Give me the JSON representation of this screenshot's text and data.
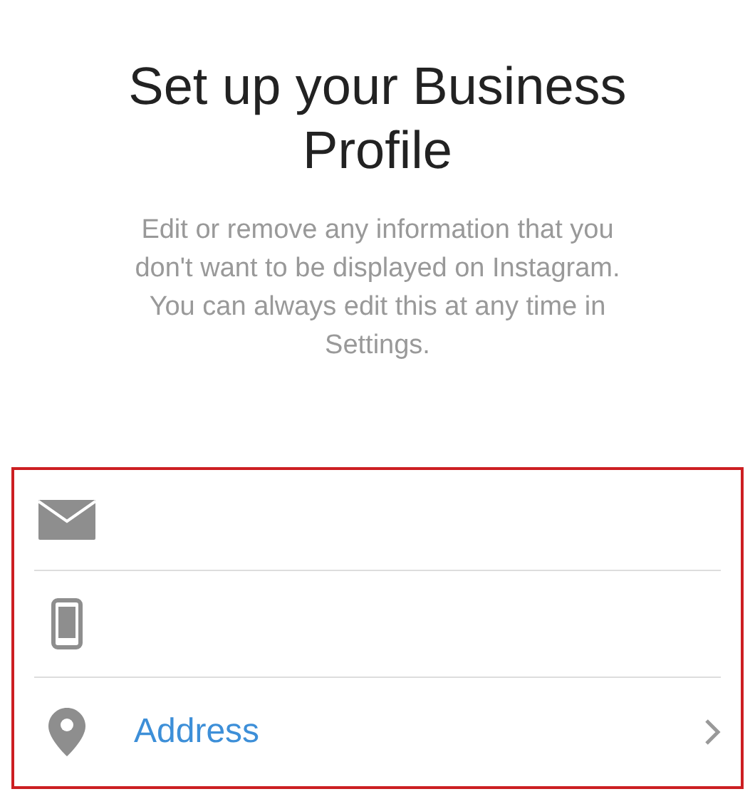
{
  "title": "Set up your Business Profile",
  "description": "Edit or remove any information that you don't want to be displayed on Instagram. You can always edit this at any time in Settings.",
  "form": {
    "highlighted": true,
    "fields": [
      {
        "kind": "email"
      },
      {
        "kind": "phone"
      },
      {
        "kind": "address",
        "label": "Address"
      }
    ]
  }
}
